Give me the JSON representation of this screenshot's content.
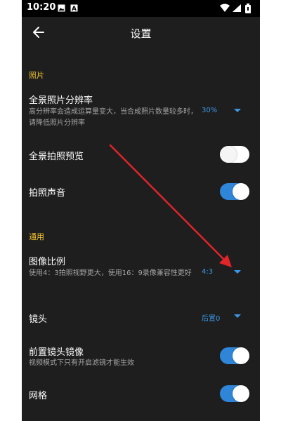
{
  "statusbar": {
    "time": "10:20",
    "left_icons": [
      "image-icon",
      "a-notification-icon"
    ],
    "right_icons": [
      "wifi-icon",
      "signal-icon",
      "battery-icon"
    ]
  },
  "toolbar": {
    "back_icon": "arrow-left-icon",
    "title": "设置"
  },
  "sections": {
    "photo": {
      "label": "照片",
      "panorama_resolution": {
        "title": "全景照片分辨率",
        "description": "高分辨率会造成运算量变大，当合成照片数量较多时，请降低照片分辨率",
        "value": "30%"
      },
      "panorama_preview": {
        "title": "全景拍照预览",
        "on": false
      },
      "shutter_sound": {
        "title": "拍照声音",
        "on": true
      }
    },
    "general": {
      "label": "通用",
      "aspect_ratio": {
        "title": "图像比例",
        "description": "使用4：3拍照视野更大，使用16：9录像兼容性更好",
        "value": "4:3"
      },
      "lens": {
        "title": "镜头",
        "value": "后置0"
      },
      "front_mirror": {
        "title": "前置镜头镜像",
        "description": "视频模式下只有开启滤镜才能生效",
        "on": true
      },
      "grid": {
        "title": "网格",
        "on": true
      }
    }
  },
  "colors": {
    "background": "#1e1e1e",
    "section_label": "#f2c230",
    "accent": "#3b97e6",
    "toggle_on": "#2f86d8",
    "annotation_arrow": "#e0242a"
  }
}
